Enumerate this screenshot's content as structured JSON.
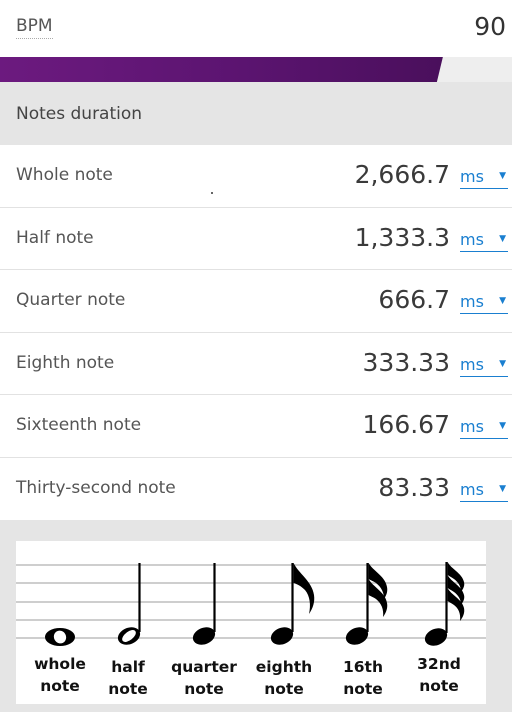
{
  "bpm": {
    "label": "BPM",
    "value": "90"
  },
  "progress": {
    "fraction": 0.865,
    "color": "#5b1470"
  },
  "section": {
    "title": "Notes duration"
  },
  "notes": [
    {
      "label": "Whole note",
      "value": "2,666.7",
      "unit": "ms"
    },
    {
      "label": "Half note",
      "value": "1,333.3",
      "unit": "ms"
    },
    {
      "label": "Quarter note",
      "value": "666.7",
      "unit": "ms"
    },
    {
      "label": "Eighth note",
      "value": "333.33",
      "unit": "ms"
    },
    {
      "label": "Sixteenth note",
      "value": "166.67",
      "unit": "ms"
    },
    {
      "label": "Thirty-second note",
      "value": "83.33",
      "unit": "ms"
    }
  ],
  "illustration": {
    "captions": [
      {
        "line1": "whole",
        "line2": "note"
      },
      {
        "line1": "half",
        "line2": "note"
      },
      {
        "line1": "quarter",
        "line2": "note"
      },
      {
        "line1": "eighth",
        "line2": "note"
      },
      {
        "line1": "16th",
        "line2": "note"
      },
      {
        "line1": "32nd",
        "line2": "note"
      }
    ]
  },
  "colors": {
    "accent": "#1a7fd0",
    "header_bg": "#e5e5e5",
    "progress": "#5b1470"
  }
}
